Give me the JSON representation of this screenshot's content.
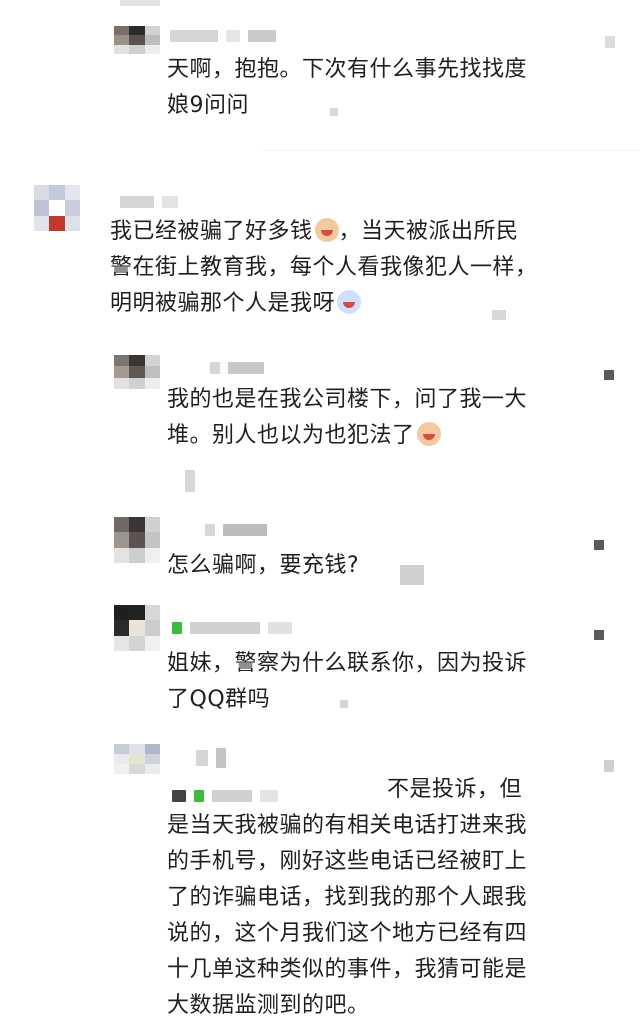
{
  "comments": [
    {
      "id": "c1",
      "text": "天啊，抱抱。下次有什么事先找找度娘9问问"
    },
    {
      "id": "c2",
      "text": "我已经被骗了好多钱",
      "text_after": "，当天被派出所民警在街上教育我，每个人看我像犯人一样，明明被骗那个人是我呀"
    },
    {
      "id": "c3",
      "text": "我的也是在我公司楼下，问了我一大堆。别人也以为也犯法了"
    },
    {
      "id": "c4",
      "text": "怎么骗啊，要充钱?"
    },
    {
      "id": "c5",
      "text": "姐妹，警察为什么联系你，因为投诉了QQ群吗"
    },
    {
      "id": "c6",
      "text": "不是投诉，但是当天我被骗的有相关电话打进来我的手机号，刚好这些电话已经被盯上了的诈骗电话，找到我的那个人跟我说的，这个月我们这个地方已经有四十几单这种类似的事件，我猜可能是大数据监测到的吧。"
    }
  ],
  "emojis": [
    "crying-face-emoji",
    "crying-face-emoji",
    "crying-face-emoji"
  ],
  "colors": {
    "text": "#1f1f1f",
    "blur": "#d6d6d6",
    "accent_green": "#3dbb3d"
  }
}
